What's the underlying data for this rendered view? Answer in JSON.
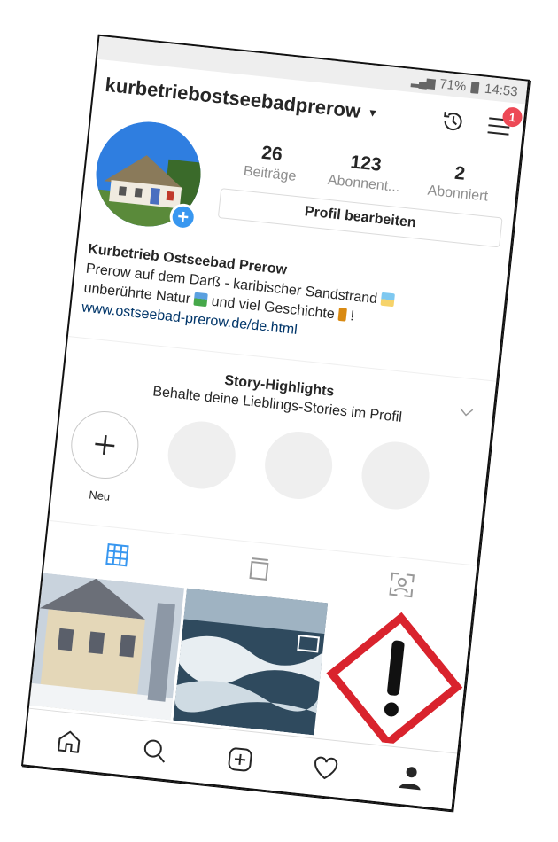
{
  "status_bar": {
    "battery": "71%",
    "time": "14:53"
  },
  "header": {
    "username": "kurbetriebostseebadprerow",
    "notification_count": "1"
  },
  "stats": [
    {
      "value": "26",
      "label": "Beiträge"
    },
    {
      "value": "123",
      "label": "Abonnent..."
    },
    {
      "value": "2",
      "label": "Abonniert"
    }
  ],
  "edit_profile_label": "Profil bearbeiten",
  "bio": {
    "name": "Kurbetrieb Ostseebad Prerow",
    "line1": "Prerow auf dem Darß - karibischer Sandstrand",
    "line2_a": "unberührte Natur",
    "line2_b": "und viel Geschichte",
    "line2_c": "!",
    "link": "www.ostseebad-prerow.de/de.html"
  },
  "highlights": {
    "title": "Story-Highlights",
    "subtitle": "Behalte deine Lieblings-Stories im Profil",
    "new_label": "Neu"
  },
  "icons": {
    "header": [
      "chevron-down-icon",
      "history-icon",
      "menu-icon"
    ],
    "tabs": [
      "grid-icon",
      "feed-icon",
      "tagged-icon"
    ],
    "nav": [
      "home-icon",
      "search-icon",
      "add-icon",
      "heart-icon",
      "profile-icon"
    ]
  },
  "colors": {
    "badge": "#ed4956",
    "add_button": "#3897f0",
    "link": "#003569",
    "warning_red": "#d9232d"
  }
}
